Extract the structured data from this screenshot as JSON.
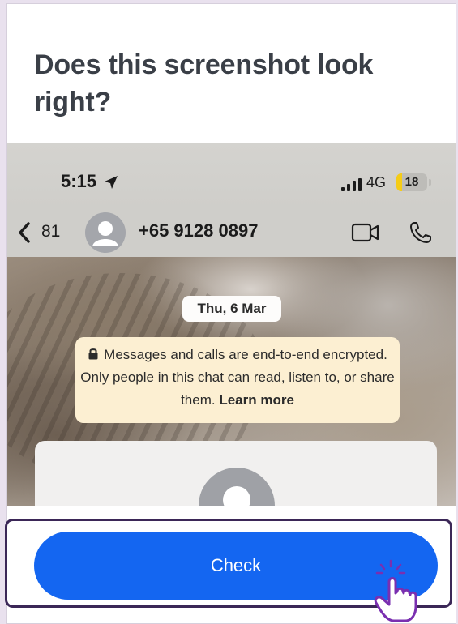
{
  "title": "Does this screenshot look right?",
  "screenshot": {
    "status_bar": {
      "time": "5:15",
      "time_icon": "location-arrow-icon",
      "signal_icon": "signal-bars-icon",
      "network": "4G",
      "battery_level": "18",
      "battery_fill_fraction": 0.18,
      "battery_color": "#f5cc16"
    },
    "chat_header": {
      "back_icon": "chevron-left-icon",
      "back_count": "81",
      "avatar_icon": "person-avatar-icon",
      "contact_name": "+65 9128 0897",
      "video_icon": "video-camera-icon",
      "call_icon": "phone-icon"
    },
    "date_pill": "Thu, 6 Mar",
    "encryption_notice": {
      "lock_icon": "lock-icon",
      "text": "Messages and calls are end-to-end encrypted. Only people in this chat can read, listen to, or share them.",
      "link": "Learn more"
    }
  },
  "check_button": {
    "label": "Check",
    "color": "#1466f1"
  },
  "pointer": {
    "icon": "tap-hand-icon"
  }
}
